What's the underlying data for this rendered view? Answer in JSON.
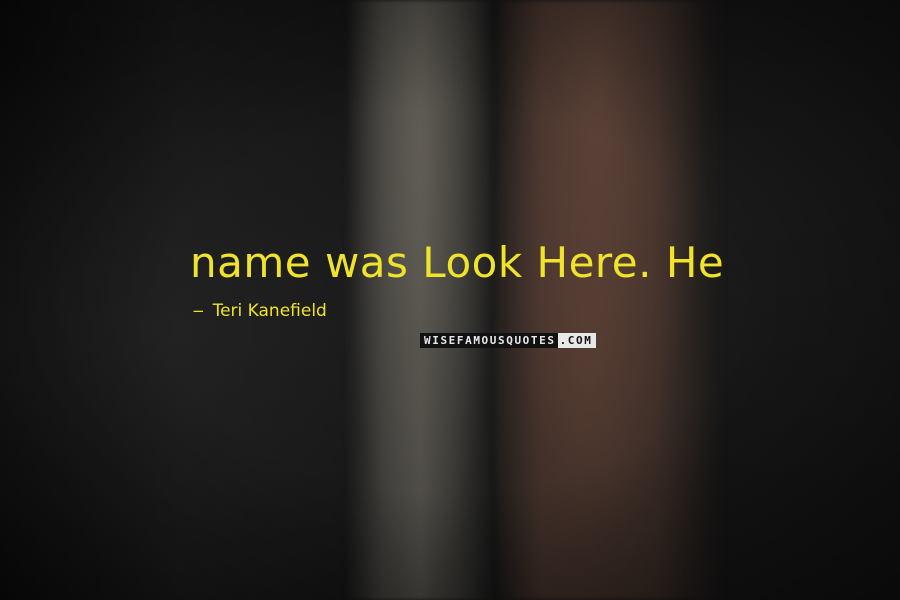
{
  "quote": {
    "text": "name was Look Here. He"
  },
  "author": {
    "dash": "−",
    "name": "Teri Kanefield"
  },
  "watermark": {
    "part1": "WISEFAMOUSQUOTES",
    "part2": ".COM"
  },
  "colors": {
    "text": "#f0e42a"
  }
}
